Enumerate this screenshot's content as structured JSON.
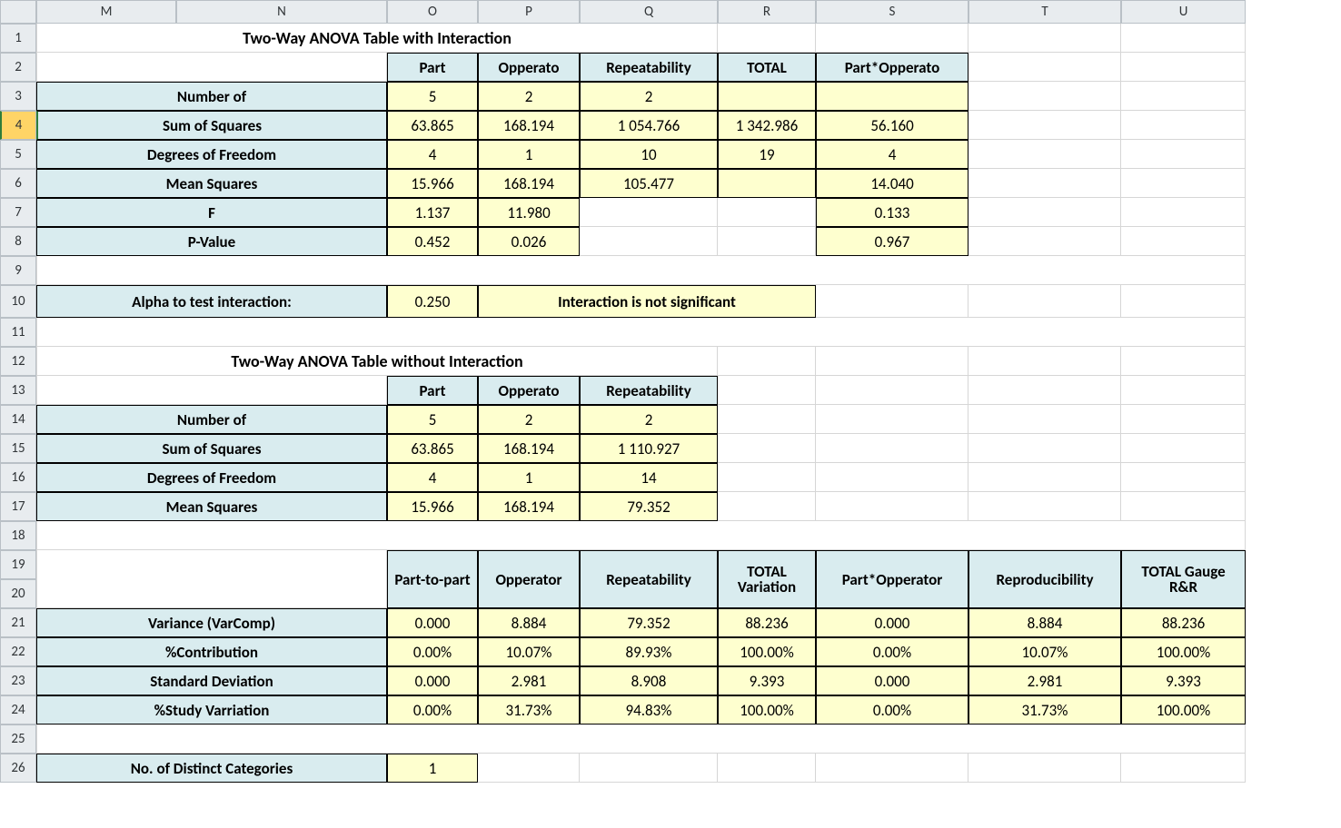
{
  "columns": [
    "M",
    "N",
    "O",
    "P",
    "Q",
    "R",
    "S",
    "T",
    "U"
  ],
  "rows": [
    "1",
    "2",
    "3",
    "4",
    "5",
    "6",
    "7",
    "8",
    "9",
    "10",
    "11",
    "12",
    "13",
    "14",
    "15",
    "16",
    "17",
    "18",
    "19",
    "20",
    "21",
    "22",
    "23",
    "24",
    "25",
    "26"
  ],
  "selected_row": "4",
  "titles": {
    "anova_with": "Two-Way ANOVA Table with Interaction",
    "anova_without": "Two-Way ANOVA Table without Interaction"
  },
  "anova_with": {
    "headers": [
      "Part",
      "Opperato",
      "Repeatability",
      "TOTAL",
      "Part*Opperato"
    ],
    "rows": {
      "numof": {
        "label": "Number of",
        "v": [
          "5",
          "2",
          "2",
          "",
          ""
        ]
      },
      "ss": {
        "label": "Sum of Squares",
        "v": [
          "63.865",
          "168.194",
          "1 054.766",
          "1 342.986",
          "56.160"
        ]
      },
      "dof": {
        "label": "Degrees of Freedom",
        "v": [
          "4",
          "1",
          "10",
          "19",
          "4"
        ]
      },
      "ms": {
        "label": "Mean Squares",
        "v": [
          "15.966",
          "168.194",
          "105.477",
          "",
          "14.040"
        ]
      },
      "f": {
        "label": "F",
        "v": [
          "1.137",
          "11.980",
          "",
          "",
          "0.133"
        ]
      },
      "p": {
        "label": "P-Value",
        "v": [
          "0.452",
          "0.026",
          "",
          "",
          "0.967"
        ]
      }
    }
  },
  "alpha": {
    "label": "Alpha to test interaction:",
    "value": "0.250",
    "note": "Interaction is not significant"
  },
  "anova_without": {
    "headers": [
      "Part",
      "Opperato",
      "Repeatability"
    ],
    "rows": {
      "numof": {
        "label": "Number of",
        "v": [
          "5",
          "2",
          "2"
        ]
      },
      "ss": {
        "label": "Sum of Squares",
        "v": [
          "63.865",
          "168.194",
          "1 110.927"
        ]
      },
      "dof": {
        "label": "Degrees of Freedom",
        "v": [
          "4",
          "1",
          "14"
        ]
      },
      "ms": {
        "label": "Mean Squares",
        "v": [
          "15.966",
          "168.194",
          "79.352"
        ]
      }
    }
  },
  "varcomp": {
    "headers": [
      "Part-to-part",
      "Opperator",
      "Repeatability",
      "TOTAL Variation",
      "Part*Opperator",
      "Reproducibility",
      "TOTAL Gauge R&R"
    ],
    "rows": {
      "var": {
        "label": "Variance (VarComp)",
        "v": [
          "0.000",
          "8.884",
          "79.352",
          "88.236",
          "0.000",
          "8.884",
          "88.236"
        ]
      },
      "contr": {
        "label": "%Contribution",
        "v": [
          "0.00%",
          "10.07%",
          "89.93%",
          "100.00%",
          "0.00%",
          "10.07%",
          "100.00%"
        ]
      },
      "sd": {
        "label": "Standard Deviation",
        "v": [
          "0.000",
          "2.981",
          "8.908",
          "9.393",
          "0.000",
          "2.981",
          "9.393"
        ]
      },
      "sv": {
        "label": "%Study Varriation",
        "v": [
          "0.00%",
          "31.73%",
          "94.83%",
          "100.00%",
          "0.00%",
          "31.73%",
          "100.00%"
        ]
      }
    }
  },
  "distinct": {
    "label": "No. of Distinct Categories",
    "value": "1"
  }
}
